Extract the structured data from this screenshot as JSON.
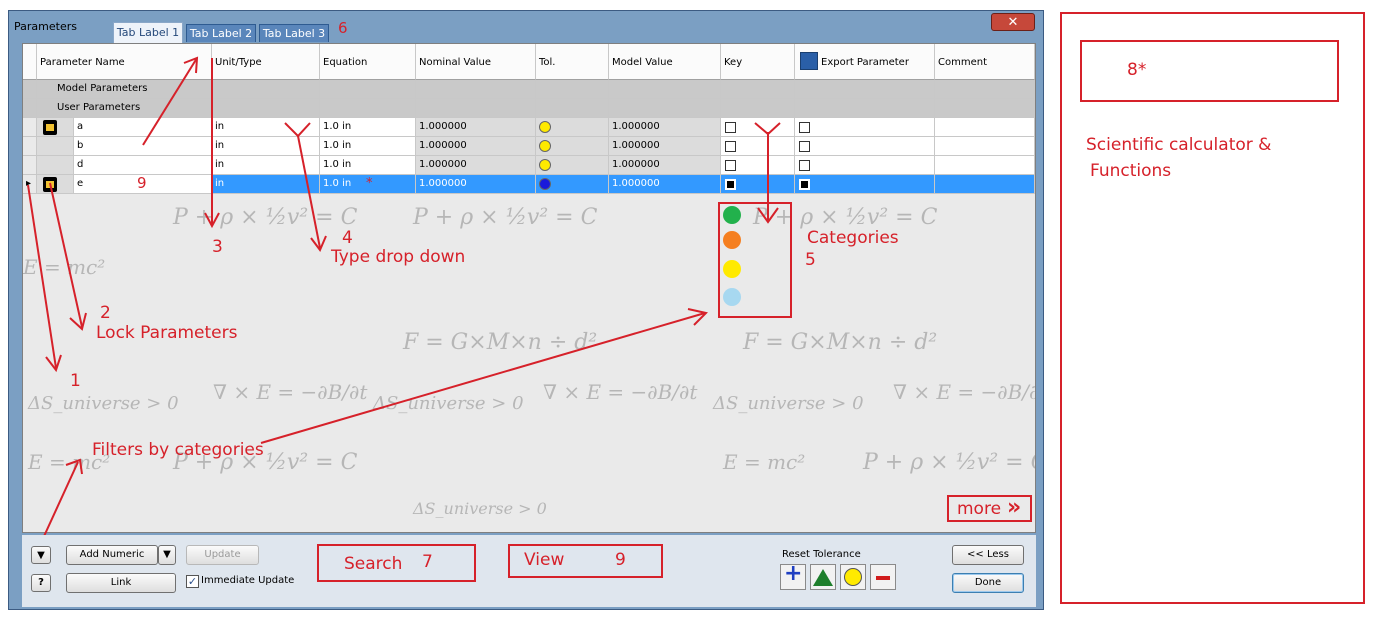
{
  "dialog": {
    "title": "Parameters",
    "close_glyph": "✕",
    "tabs": [
      "Tab Label 1",
      "Tab Label 2",
      "Tab Label 3"
    ],
    "tab_number": "6"
  },
  "grid": {
    "columns": [
      "Parameter Name",
      "Unit/Type",
      "Equation",
      "Nominal Value",
      "Tol.",
      "Model Value",
      "Key",
      "Export Parameter",
      "Comment"
    ],
    "groups": [
      "Model Parameters",
      "User Parameters"
    ],
    "rows": [
      {
        "name": "a",
        "unit": "in",
        "equation": "1.0 in",
        "nominal": "1.000000",
        "model": "1.000000",
        "tol_color": "#ffea00",
        "locked": true
      },
      {
        "name": "b",
        "unit": "in",
        "equation": "1.0 in",
        "nominal": "1.000000",
        "model": "1.000000",
        "tol_color": "#ffea00",
        "locked": false
      },
      {
        "name": "d",
        "unit": "in",
        "equation": "1.0 in",
        "nominal": "1.000000",
        "model": "1.000000",
        "tol_color": "#ffea00",
        "locked": false
      },
      {
        "name": "e",
        "unit": "in",
        "equation": "1.0 in",
        "nominal": "1.000000",
        "model": "1.000000",
        "tol_color": "#1a1adb",
        "locked": true,
        "selected": true,
        "marker": "9",
        "asterisk": "*"
      }
    ]
  },
  "categories": {
    "label": "Categories",
    "number": "5",
    "colors": [
      "#22b14c",
      "#f57f20",
      "#ffea00",
      "#a7d8f0"
    ]
  },
  "annotations": {
    "n1": "1",
    "n2": "2",
    "lock": "Lock Parameters",
    "n3": "3",
    "n4": "4",
    "type_dropdown": "Type drop down",
    "filters": "Filters by categories",
    "more": "more",
    "more_glyph": "»",
    "search": "Search",
    "n7": "7",
    "view": "View",
    "n9": "9",
    "n8": "8*",
    "calc_line1": "Scientific calculator &",
    "calc_line2": "Functions"
  },
  "bottom": {
    "add_numeric": "Add Numeric",
    "update": "Update",
    "link": "Link",
    "immediate_update": "Immediate Update",
    "reset_tolerance": "Reset Tolerance",
    "less": "<< Less",
    "done": "Done",
    "help_glyph": "?"
  },
  "watermark": {
    "formulas": [
      "E = mc²",
      "P + ρ × ½v² = C",
      "F = G×M×n ÷ d²",
      "∇ × E = −∂B/∂t",
      "ΔS_universe > 0"
    ]
  }
}
